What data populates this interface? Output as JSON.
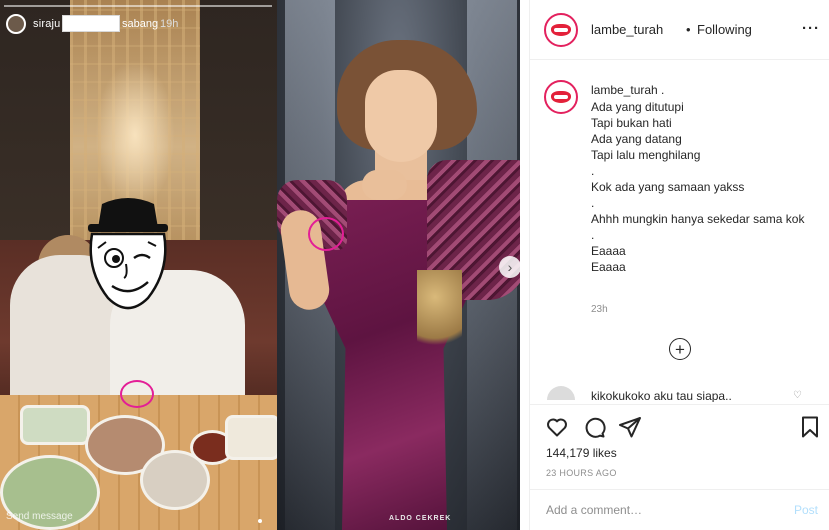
{
  "story": {
    "username_start": "siraju",
    "username_end": "sabang",
    "time": "19h",
    "send_message": "Send message"
  },
  "photo": {
    "watermark": "ALDO CEKREK"
  },
  "post": {
    "username": "lambe_turah",
    "separator": "•",
    "follow_status": "Following",
    "caption_user": "lambe_turah .",
    "caption_lines": [
      "Ada yang ditutupi",
      "Tapi bukan hati",
      "Ada yang datang",
      "Tapi lalu menghilang",
      ".",
      "Kok ada yang samaan yakss",
      ".",
      "Ahhh mungkin hanya sekedar sama kok",
      ".",
      "Eaaaa",
      "Eaaaa"
    ],
    "caption_time": "23h",
    "comment_user": "kikokukoko",
    "comment_text": "aku tau siapa..",
    "likes": "144,179 likes",
    "age": "23 HOURS AGO",
    "comment_placeholder": "Add a comment…",
    "post_label": "Post"
  },
  "colors": {
    "highlight_circle": "#e31e96",
    "avatar_ring": "#e3215e",
    "post_button": "#b2dffc"
  },
  "icons": [
    "more-icon",
    "load-more-icon",
    "next-arrow-icon",
    "heart-icon",
    "comment-icon",
    "share-icon",
    "bookmark-icon"
  ]
}
